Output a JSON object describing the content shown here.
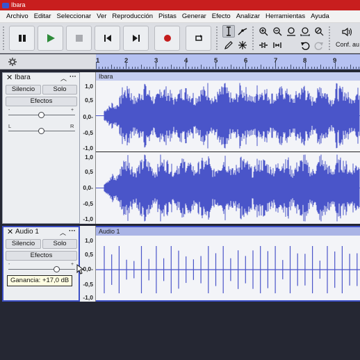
{
  "window": {
    "title": "Ibara"
  },
  "menu": [
    "Archivo",
    "Editar",
    "Seleccionar",
    "Ver",
    "Reproducción",
    "Pistas",
    "Generar",
    "Efecto",
    "Analizar",
    "Herramientas",
    "Ayuda"
  ],
  "toolbar": {
    "audio_setup_label": "Conf. au"
  },
  "ruler": {
    "ticks": [
      "1",
      "2",
      "3",
      "4",
      "5",
      "6",
      "7",
      "8",
      "9"
    ]
  },
  "tracks": [
    {
      "name": "Ibara",
      "mute": "Silencio",
      "solo": "Solo",
      "effects": "Efectos",
      "gain_minus": "-",
      "gain_plus": "+",
      "pan_left": "L",
      "pan_right": "R",
      "clip_name": "Ibara",
      "channels": [
        {
          "scale": [
            "1,0",
            "0,5",
            "0,0-",
            "-0,5",
            "-1,0"
          ]
        },
        {
          "scale": [
            "1,0",
            "0,5",
            "0,0-",
            "-0,5",
            "-1,0"
          ]
        }
      ]
    },
    {
      "name": "Audio 1",
      "mute": "Silencio",
      "solo": "Solo",
      "effects": "Efectos",
      "gain_minus": "-",
      "gain_plus": "+",
      "clip_name": "Audio 1",
      "channels": [
        {
          "scale": [
            "1,0",
            "0,5",
            "0,0-",
            "-0,5",
            "-1,0"
          ]
        }
      ]
    }
  ],
  "tooltip": {
    "text": "Ganancia: +17,0 dB"
  },
  "colors": {
    "waveform": "#4a55c9",
    "selected_border": "#3d4fc6",
    "titlebar": "#c81e1e",
    "ruler": "#b5c1f1"
  }
}
